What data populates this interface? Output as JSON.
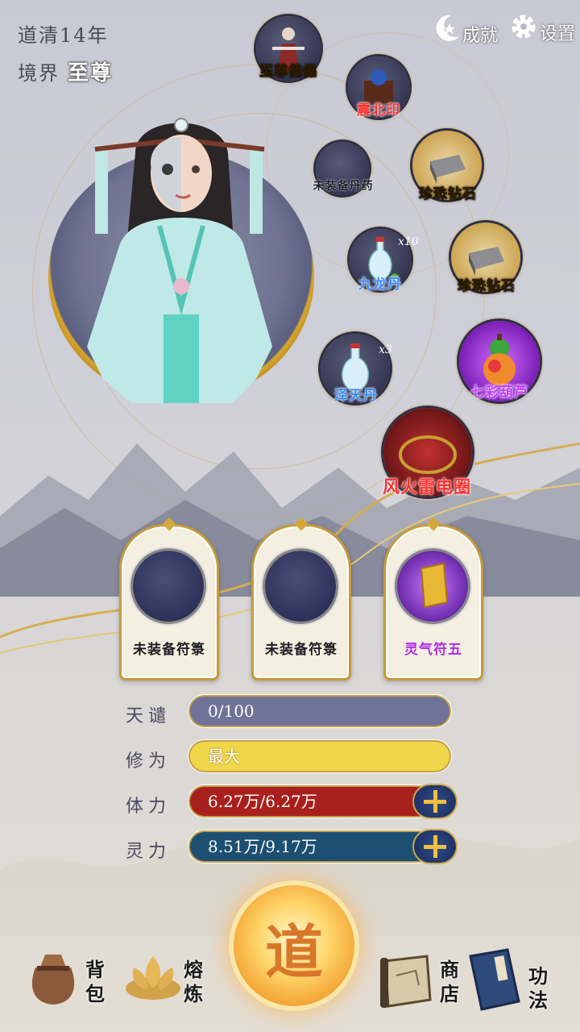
{
  "header": {
    "year_text": "道清14年",
    "realm_label": "境界",
    "realm_value": "至尊",
    "achievements_label": "成就",
    "settings_label": "设置"
  },
  "orbs": [
    {
      "id": "puppet",
      "label": "至尊傀儡",
      "color": "gold"
    },
    {
      "id": "seal",
      "label": "震北印",
      "color": "red"
    },
    {
      "id": "pill_empty",
      "label": "未装备丹药",
      "color": "dark"
    },
    {
      "id": "pearl1",
      "label": "珍珠钻石",
      "color": "gold"
    },
    {
      "id": "dragon_pill",
      "label": "九龙丹",
      "color": "blue",
      "count": "x10"
    },
    {
      "id": "pearl2",
      "label": "珍珠钻石",
      "color": "gold"
    },
    {
      "id": "heaven_pill",
      "label": "泽天丹",
      "color": "blue",
      "count": "x3"
    },
    {
      "id": "gourd",
      "label": "七彩葫芦",
      "color": "purple"
    },
    {
      "id": "ring",
      "label": "风火雷电圈",
      "color": "red"
    }
  ],
  "talismans": [
    {
      "label": "未装备符箓",
      "equipped": false
    },
    {
      "label": "未装备符箓",
      "equipped": false
    },
    {
      "label": "灵气符五",
      "equipped": true
    }
  ],
  "stats": [
    {
      "name": "天谴",
      "value": "0/100",
      "fill": 0.0,
      "color": "#6f7397"
    },
    {
      "name": "修为",
      "value": "最大",
      "fill": 1.0,
      "color": "#efd64a"
    },
    {
      "name": "体力",
      "value": "6.27万/6.27万",
      "fill": 1.0,
      "color": "#a8201c"
    },
    {
      "name": "灵力",
      "value": "8.51万/9.17万",
      "fill": 0.93,
      "color": "#1d4f72"
    }
  ],
  "nav": {
    "bag": "背包",
    "smelt": "熔炼",
    "center": "道",
    "shop": "商店",
    "skills": "功法"
  }
}
